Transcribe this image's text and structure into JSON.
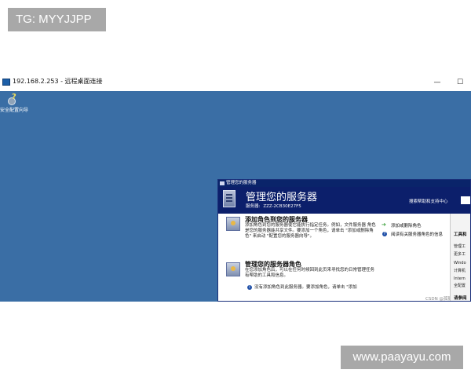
{
  "watermark_top": "TG: MYYJJPP",
  "watermark_bottom": "www.paayayu.com",
  "rdp_window": {
    "title": "192.168.2.253 - 远程桌面连接",
    "minimize_glyph": "—",
    "maximize_glyph": "☐"
  },
  "desktop": {
    "background_color": "#3a6ea5",
    "icons": [
      {
        "label": "安全配置向导",
        "icon": "gear-question-icon"
      }
    ]
  },
  "manage_server": {
    "window_title": "管理您的服务器",
    "heading": "管理您的服务器",
    "server_label": "服务器:",
    "server_name": "ZZZ-2CB30E27F5",
    "search_label": "搜索帮助和支持中心",
    "search_value": "",
    "sections": [
      {
        "title": "添加角色到您的服务器",
        "description": "添加角色到您的服务器使它能执行指定任务。例如，文件服务器 角色是您的服务器能共享文件。要添加一个角色，请单击 \"添加或删除角色\" 来启动 \"配置您的服务器向导\"。"
      },
      {
        "title": "管理您的服务器角色",
        "description": "在您添加角色后，可以在任何时候回到此页来寻找您的日常管理任务有帮助的工具和信息。",
        "note": "没有添加角色到此服务器。要添加角色，请单击 \"添加"
      }
    ],
    "links": [
      {
        "label": "添加或删除角色",
        "icon": "green-arrow-icon"
      },
      {
        "label": "阅读有关服务器角色的信息",
        "icon": "help-icon"
      }
    ],
    "tools_panel": {
      "title": "工具和",
      "items": [
        "管理工",
        "更多工",
        "Windo",
        "计算机",
        "Intern",
        "全配置"
      ],
      "bottom_title": "请参阅"
    },
    "watermark": "CSDN @孤影无尘"
  }
}
